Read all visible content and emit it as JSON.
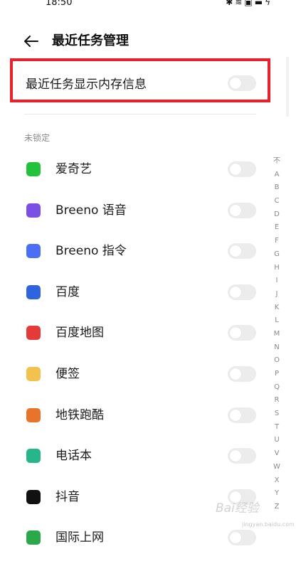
{
  "status": {
    "time": "18:50",
    "icons": [
      "bluetooth-icon",
      "wifi-icon",
      "sim-icon",
      "battery-charging-icon"
    ]
  },
  "header": {
    "title": "最近任务管理"
  },
  "memory_toggle": {
    "label": "最近任务显示内存信息",
    "on": false
  },
  "section_label": "未锁定",
  "apps": [
    {
      "name": "爱奇艺",
      "icon": "iqiyi-icon",
      "color": "#22c23a",
      "on": false
    },
    {
      "name": "Breeno 语音",
      "icon": "breeno-voice-icon",
      "color": "#7b4fe3",
      "on": false
    },
    {
      "name": "Breeno 指令",
      "icon": "breeno-command-icon",
      "color": "#4a6ef5",
      "on": false
    },
    {
      "name": "百度",
      "icon": "baidu-icon",
      "color": "#2f64e0",
      "on": false
    },
    {
      "name": "百度地图",
      "icon": "baidu-map-icon",
      "color": "#e53a3a",
      "on": false
    },
    {
      "name": "便签",
      "icon": "notes-icon",
      "color": "#f2c14e",
      "on": false
    },
    {
      "name": "地铁跑酷",
      "icon": "subway-surfers-icon",
      "color": "#e8732b",
      "on": false
    },
    {
      "name": "电话本",
      "icon": "contacts-icon",
      "color": "#27b58a",
      "on": false
    },
    {
      "name": "抖音",
      "icon": "douyin-icon",
      "color": "#111111",
      "on": false
    },
    {
      "name": "国际上网",
      "icon": "global-internet-icon",
      "color": "#2aa84a",
      "on": false
    }
  ],
  "alpha_index": [
    "不",
    "A",
    "B",
    "C",
    "D",
    "E",
    "F",
    "G",
    "H",
    "I",
    "J",
    "K",
    "L",
    "M",
    "N",
    "O",
    "P",
    "Q",
    "R",
    "S",
    "T",
    "U",
    "V",
    "W",
    "X",
    "Y",
    "Z"
  ],
  "watermark": {
    "text": "Bai经验",
    "sub": "jingyan.baidu.com"
  }
}
